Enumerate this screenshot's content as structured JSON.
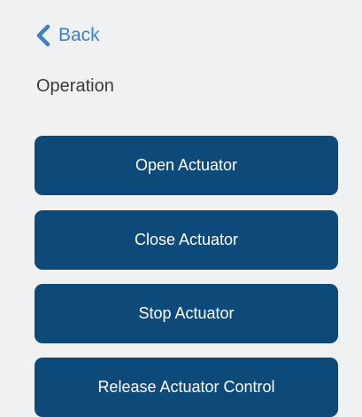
{
  "nav": {
    "back_label": "Back",
    "back_icon": "chevron-left-icon",
    "accent_color": "#3f80c4"
  },
  "section": {
    "title": "Operation"
  },
  "actions": {
    "button_color": "#0e4a79",
    "open_label": "Open Actuator",
    "close_label": "Close Actuator",
    "stop_label": "Stop Actuator",
    "release_label": "Release Actuator Control"
  }
}
